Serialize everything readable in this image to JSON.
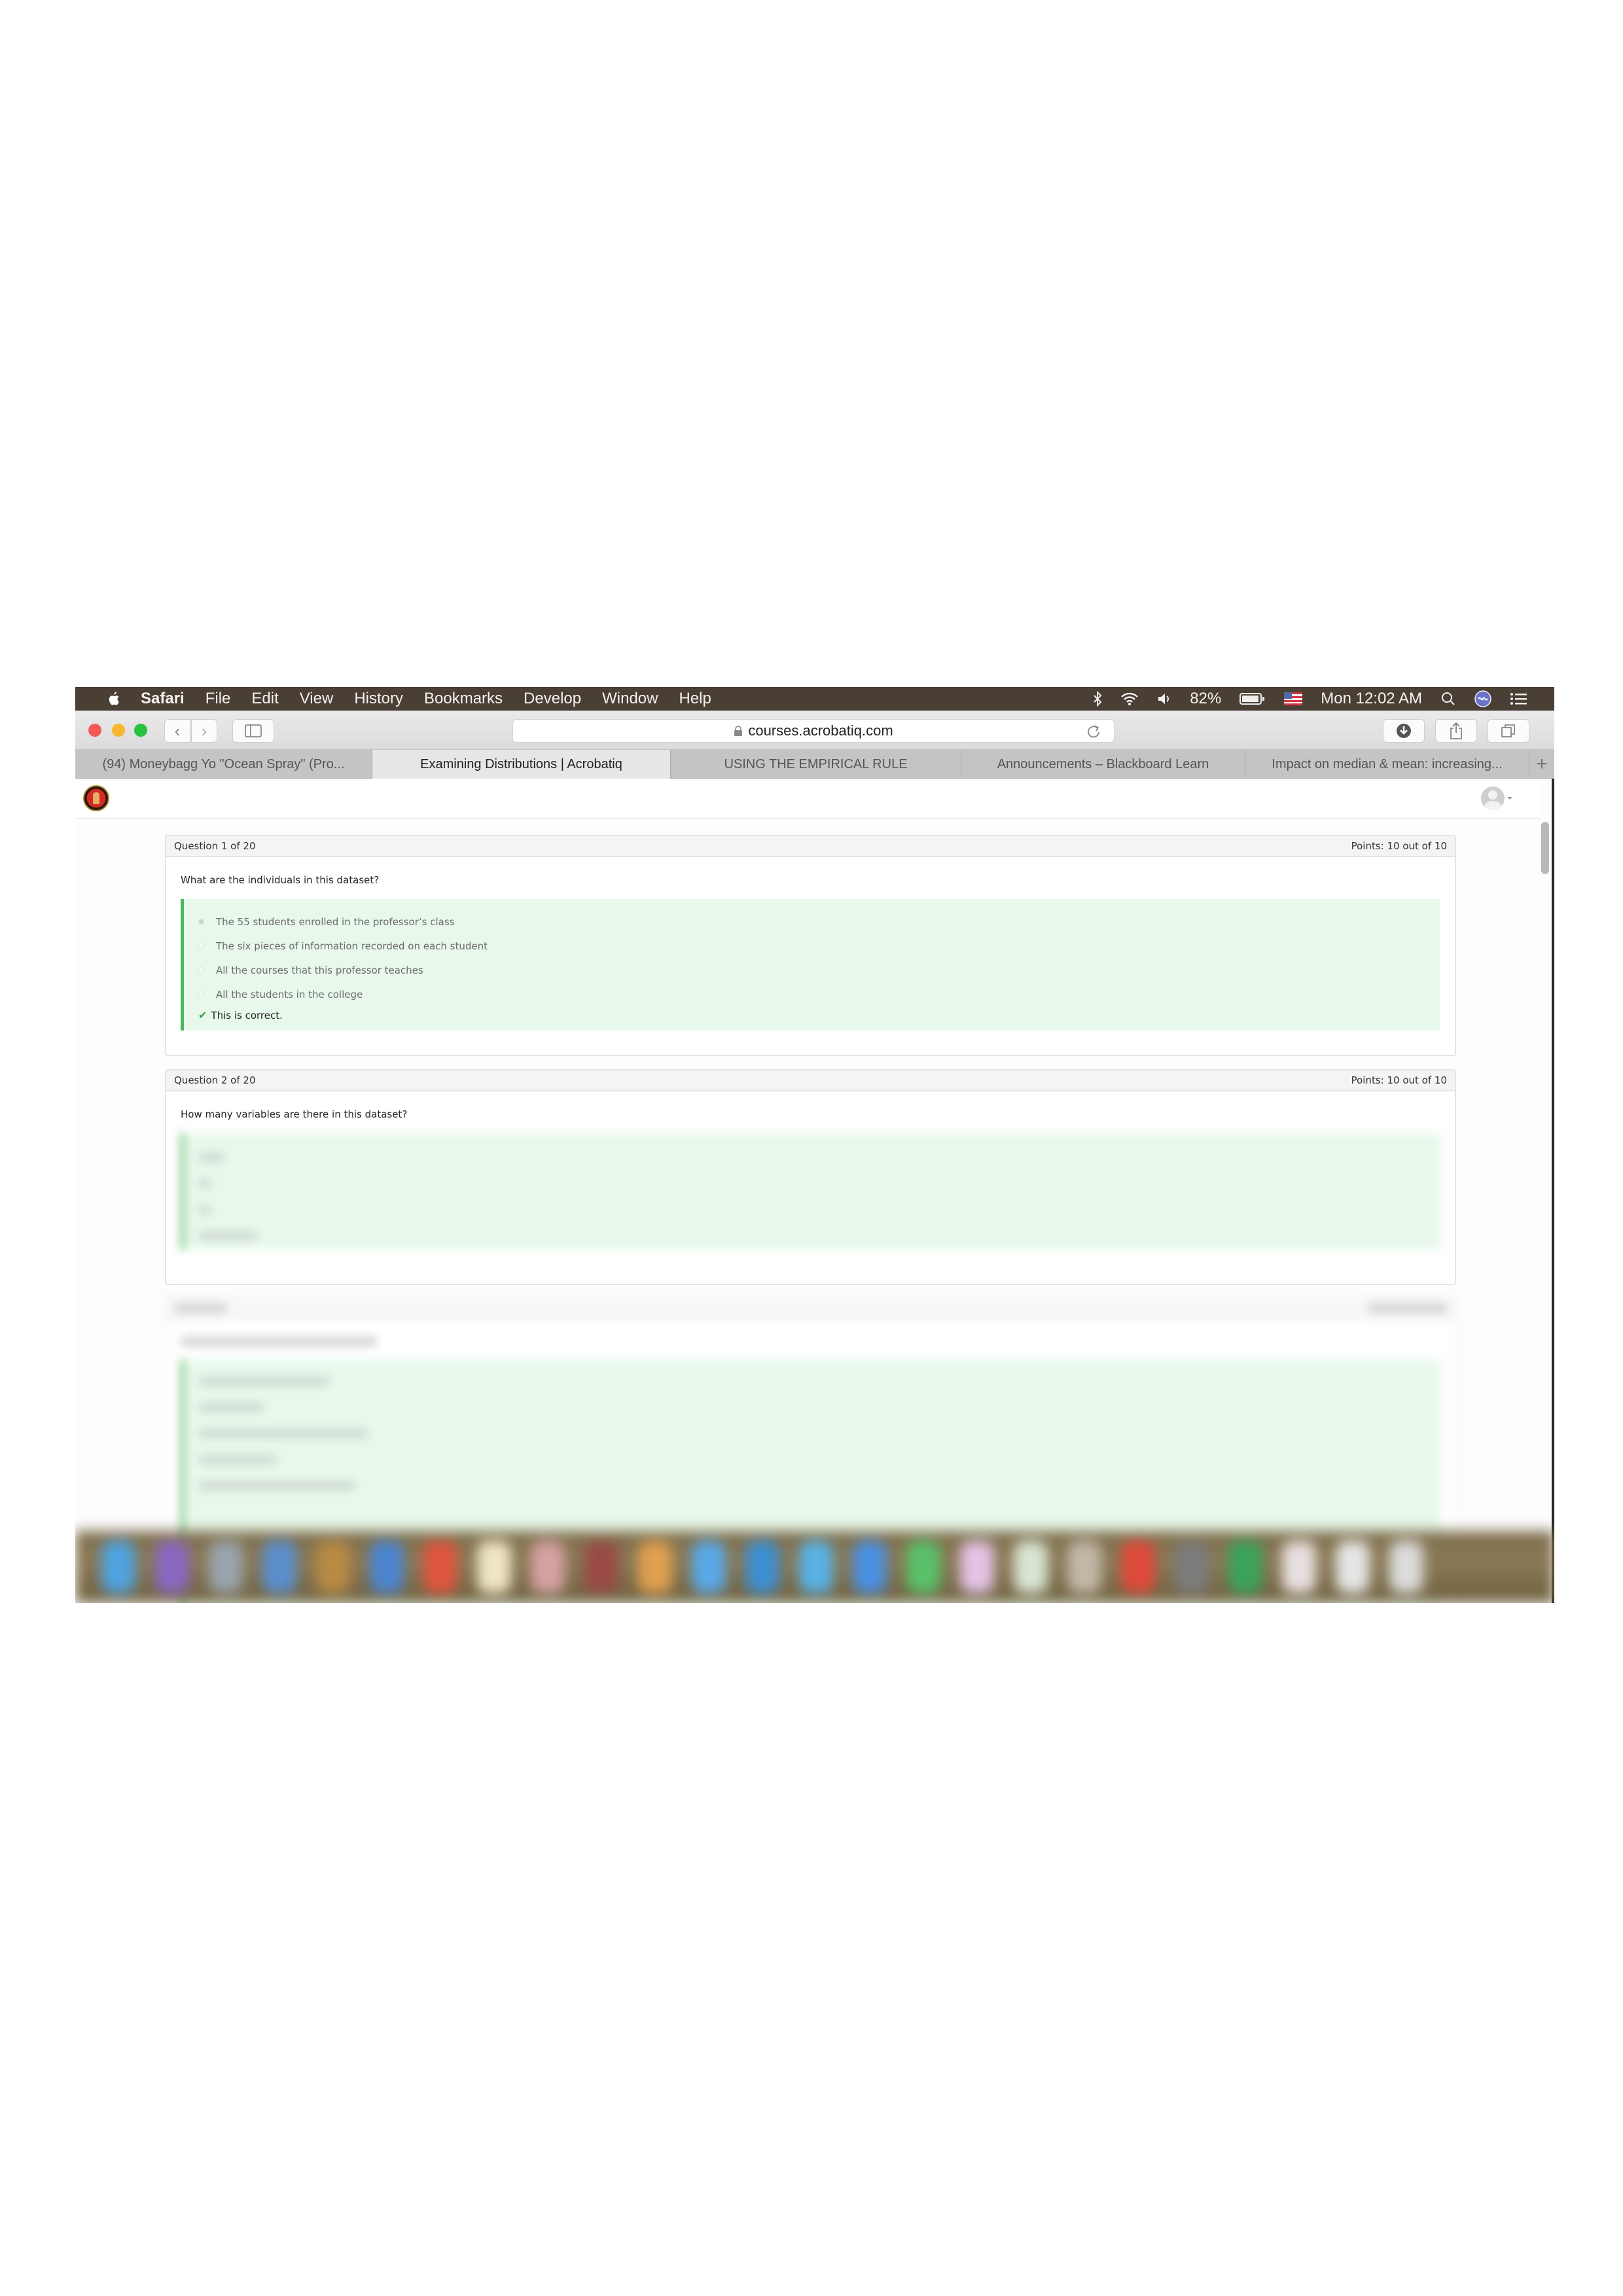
{
  "menubar": {
    "app_name": "Safari",
    "items": [
      "File",
      "Edit",
      "View",
      "History",
      "Bookmarks",
      "Develop",
      "Window",
      "Help"
    ],
    "battery_percent": "82%",
    "clock": "Mon 12:02 AM",
    "status_icons": [
      "bluetooth-icon",
      "wifi-icon",
      "volume-icon",
      "battery-icon",
      "us-flag-icon",
      "spotlight-search-icon",
      "siri-icon",
      "notification-center-icon"
    ]
  },
  "toolbar": {
    "url": "courses.acrobatiq.com",
    "back_glyph": "‹",
    "forward_glyph": "›"
  },
  "tabs": [
    {
      "label": "(94) Moneybagg Yo \"Ocean Spray\" (Pro...",
      "active": false
    },
    {
      "label": "Examining Distributions | Acrobatiq",
      "active": true
    },
    {
      "label": "USING THE EMPIRICAL RULE",
      "active": false
    },
    {
      "label": "Announcements – Blackboard Learn",
      "active": false
    },
    {
      "label": "Impact on median & mean: increasing...",
      "active": false
    }
  ],
  "new_tab_glyph": "+",
  "questions": [
    {
      "header": "Question 1 of 20",
      "points": "Points: 10 out of 10",
      "prompt": "What are the individuals in this dataset?",
      "options": [
        {
          "label": "The 55 students enrolled in the professor’s class",
          "selected": true
        },
        {
          "label": "The six pieces of information recorded on each student",
          "selected": false
        },
        {
          "label": "All the courses that this professor teaches",
          "selected": false
        },
        {
          "label": "All the students in the college",
          "selected": false
        }
      ],
      "feedback": "This is correct.",
      "check_glyph": "✔"
    },
    {
      "header": "Question 2 of 20",
      "points": "Points: 10 out of 10",
      "prompt": "How many variables are there in this dataset?"
    }
  ],
  "colors": {
    "menubar_bg": "#4a3f35",
    "correct_green": "#4cb85b",
    "answer_bg": "#e8f8eb",
    "check_green": "#2fa53b"
  },
  "dock_icon_colors": [
    "#4fa3e0",
    "#8a67c2",
    "#9aa4ad",
    "#5a8fcf",
    "#b98a44",
    "#4b85d0",
    "#e0553e",
    "#efe6c6",
    "#d6a2a2",
    "#9a4a45",
    "#e0a050",
    "#59a9e8",
    "#3c8fd2",
    "#58b2e6",
    "#4a90e2",
    "#5ac16a",
    "#e3c3e6",
    "#d9e6d4",
    "#c2b8a8",
    "#e04a3a",
    "#7c7c7c",
    "#3aa35a",
    "#e8e0e0",
    "#e6e6e6",
    "#dcdcdc"
  ]
}
